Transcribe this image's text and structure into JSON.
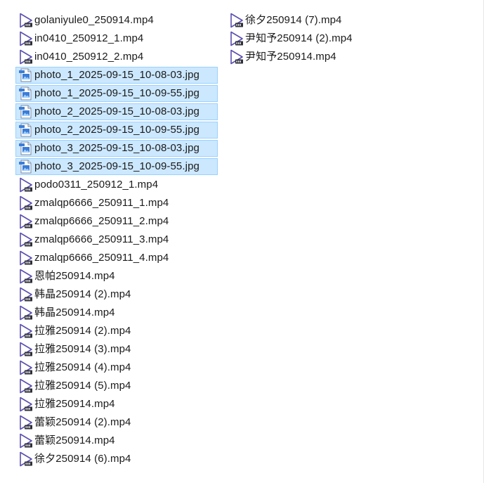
{
  "colors": {
    "selection_bg": "#cce8ff",
    "selection_border": "#99d1ff",
    "video_icon": "#5a4fb0",
    "image_icon": "#3b7dd8",
    "text": "#1a1a1a"
  },
  "files": {
    "column1": [
      {
        "name": "golaniyule0_250914.mp4",
        "type": "video",
        "selected": false
      },
      {
        "name": "in0410_250912_1.mp4",
        "type": "video",
        "selected": false
      },
      {
        "name": "in0410_250912_2.mp4",
        "type": "video",
        "selected": false
      },
      {
        "name": "photo_1_2025-09-15_10-08-03.jpg",
        "type": "image",
        "selected": true
      },
      {
        "name": "photo_1_2025-09-15_10-09-55.jpg",
        "type": "image",
        "selected": true
      },
      {
        "name": "photo_2_2025-09-15_10-08-03.jpg",
        "type": "image",
        "selected": true
      },
      {
        "name": "photo_2_2025-09-15_10-09-55.jpg",
        "type": "image",
        "selected": true
      },
      {
        "name": "photo_3_2025-09-15_10-08-03.jpg",
        "type": "image",
        "selected": true
      },
      {
        "name": "photo_3_2025-09-15_10-09-55.jpg",
        "type": "image",
        "selected": true
      },
      {
        "name": "podo0311_250912_1.mp4",
        "type": "video",
        "selected": false
      },
      {
        "name": "zmalqp6666_250911_1.mp4",
        "type": "video",
        "selected": false
      },
      {
        "name": "zmalqp6666_250911_2.mp4",
        "type": "video",
        "selected": false
      },
      {
        "name": "zmalqp6666_250911_3.mp4",
        "type": "video",
        "selected": false
      },
      {
        "name": "zmalqp6666_250911_4.mp4",
        "type": "video",
        "selected": false
      },
      {
        "name": "恩帕250914.mp4",
        "type": "video",
        "selected": false
      },
      {
        "name": "韩晶250914 (2).mp4",
        "type": "video",
        "selected": false
      },
      {
        "name": "韩晶250914.mp4",
        "type": "video",
        "selected": false
      },
      {
        "name": "拉雅250914 (2).mp4",
        "type": "video",
        "selected": false
      },
      {
        "name": "拉雅250914 (3).mp4",
        "type": "video",
        "selected": false
      },
      {
        "name": "拉雅250914 (4).mp4",
        "type": "video",
        "selected": false
      },
      {
        "name": "拉雅250914 (5).mp4",
        "type": "video",
        "selected": false
      },
      {
        "name": "拉雅250914.mp4",
        "type": "video",
        "selected": false
      },
      {
        "name": "蕾颖250914 (2).mp4",
        "type": "video",
        "selected": false
      },
      {
        "name": "蕾颖250914.mp4",
        "type": "video",
        "selected": false
      },
      {
        "name": "徐夕250914 (6).mp4",
        "type": "video",
        "selected": false
      }
    ],
    "column2": [
      {
        "name": "徐夕250914 (7).mp4",
        "type": "video",
        "selected": false
      },
      {
        "name": "尹知予250914 (2).mp4",
        "type": "video",
        "selected": false
      },
      {
        "name": "尹知予250914.mp4",
        "type": "video",
        "selected": false
      }
    ]
  },
  "icons": {
    "video": "video-file-icon",
    "image": "image-file-icon"
  }
}
